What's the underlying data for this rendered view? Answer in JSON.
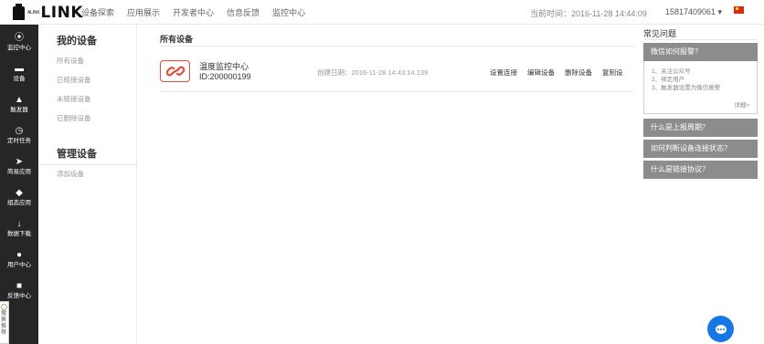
{
  "header": {
    "logo_small": "ALINK",
    "logo_text": "LINK",
    "nav": [
      "设备探索",
      "应用展示",
      "开发者中心",
      "信息反馈",
      "监控中心"
    ],
    "current_time": "当前时间：2016-11-28 14:44:09",
    "user": "15817409061 ▾",
    "accent_color": "#e74c3c"
  },
  "sidebar": {
    "items": [
      {
        "icon": "dashboard-icon",
        "label": "监控中心"
      },
      {
        "icon": "device-icon",
        "label": "设备"
      },
      {
        "icon": "bell-icon",
        "label": "触发器"
      },
      {
        "icon": "clock-icon",
        "label": "定时任务"
      },
      {
        "icon": "send-icon",
        "label": "简易应用"
      },
      {
        "icon": "puzzle-icon",
        "label": "组态应用"
      },
      {
        "icon": "download-icon",
        "label": "数据下载"
      },
      {
        "icon": "user-icon",
        "label": "用户中心"
      },
      {
        "icon": "chat-icon",
        "label": "反馈中心"
      }
    ],
    "tag_text": [
      "搜",
      "索",
      "推",
      "荐"
    ]
  },
  "submenu": {
    "my_devices_title": "我的设备",
    "my_devices": [
      "所有设备",
      "已链接设备",
      "未链接设备",
      "已删除设备"
    ],
    "manage_title": "管理设备",
    "manage": [
      "添加设备"
    ]
  },
  "main": {
    "title": "所有设备",
    "device": {
      "name": "温度监控中心",
      "id": "ID:200000199",
      "created": "创建日期：2016-11-28 14:43:14.139",
      "actions": [
        "设置连接",
        "编辑设备",
        "删除设备",
        "复制设"
      ]
    }
  },
  "faq": {
    "title": "常见问题",
    "items": [
      "微信如何报警？",
      "什么是上报周期？",
      "如何判断设备连接状态？",
      "什么是链接协议？"
    ],
    "expanded_lines": [
      "1、关注公众号",
      "2、绑定用户",
      "3、触发器设置为微信报警"
    ],
    "more_label": "详细>"
  }
}
